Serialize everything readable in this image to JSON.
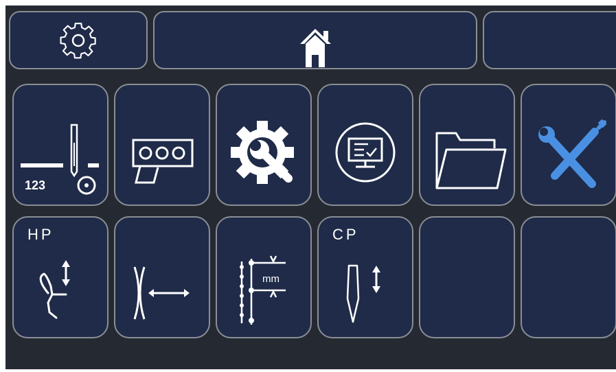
{
  "header": {
    "settings": {
      "icon": "gear-outline-icon"
    },
    "home": {
      "icon": "home-icon"
    },
    "extra": {
      "label": ""
    }
  },
  "row1": [
    {
      "icon": "needle-count-123-icon",
      "text": "123"
    },
    {
      "icon": "pattern-ooo-icon"
    },
    {
      "icon": "gear-wrench-icon"
    },
    {
      "icon": "monitor-circle-icon"
    },
    {
      "icon": "folder-open-icon"
    },
    {
      "icon": "tools-wrench-screwdriver-icon",
      "accent": "#4a90e2"
    }
  ],
  "row2": [
    {
      "label": "HP",
      "icon": "presser-foot-height-icon"
    },
    {
      "icon": "width-adjust-icon"
    },
    {
      "icon": "stitch-length-mm-icon",
      "unit": "mm"
    },
    {
      "label": "CP",
      "icon": "needle-position-icon"
    },
    {
      "icon": ""
    },
    {
      "icon": ""
    }
  ],
  "colors": {
    "screen": "#252a32",
    "tile": "#1f2b48",
    "border": "#8a8e95",
    "accent": "#4a90e2"
  }
}
